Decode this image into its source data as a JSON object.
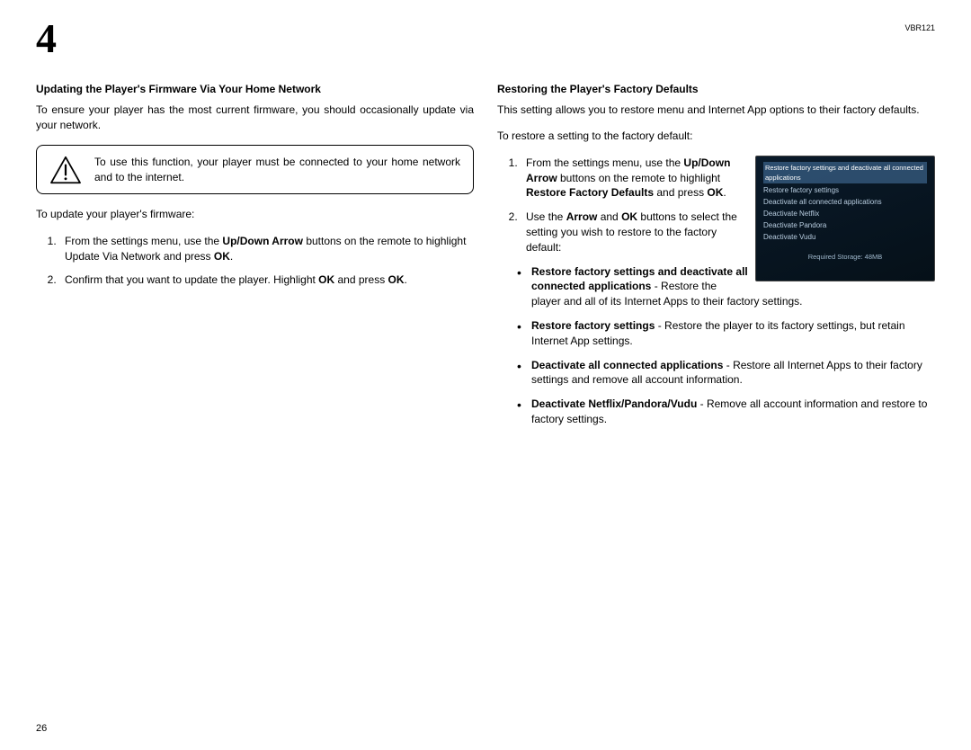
{
  "header": {
    "chapter": "4",
    "model": "VBR121"
  },
  "left": {
    "heading": "Updating the Player's Firmware Via Your Home Network",
    "intro": "To ensure your player has the most current firmware, you should occasionally update via your network.",
    "alert": "To use this function, your player must be connected to your home network and to the internet.",
    "lead": "To update your player's firmware:",
    "steps": {
      "s1_pre": "From the settings menu, use the ",
      "s1_b1": "Up/Down Arrow",
      "s1_mid": " buttons on the remote to highlight Update Via Network and press ",
      "s1_b2": "OK",
      "s1_post": ".",
      "s2_pre": "Confirm that you want to update the player. Highlight ",
      "s2_b1": "OK",
      "s2_mid": " and press ",
      "s2_b2": "OK",
      "s2_post": "."
    }
  },
  "right": {
    "heading": "Restoring the Player's Factory Defaults",
    "intro": "This setting allows you to restore menu and Internet App options to their factory defaults.",
    "lead": "To restore a setting to the factory default:",
    "steps": {
      "s1_pre": "From the settings menu, use the ",
      "s1_b1": "Up/Down Arrow",
      "s1_mid": " buttons on the remote to highlight ",
      "s1_b2": "Restore Factory Defaults",
      "s1_mid2": " and press ",
      "s1_b3": "OK",
      "s1_post": ".",
      "s2_pre": "Use the ",
      "s2_b1": "Arrow",
      "s2_mid": " and ",
      "s2_b2": "OK",
      "s2_post": " buttons to select the setting you wish to restore to the factory default:"
    },
    "bullets": {
      "b1_bold": "Restore factory settings and deactivate all connected applications",
      "b1_rest": " - Restore the player and all of its Internet Apps to their factory settings.",
      "b2_bold": "Restore factory settings",
      "b2_rest": " - Restore the player to its factory settings, but retain Internet App settings.",
      "b3_bold": "Deactivate all connected applications",
      "b3_rest": " - Restore all Internet Apps to their factory settings and remove all account information.",
      "b4_bold": "Deactivate Netflix/Pandora/Vudu",
      "b4_rest": " - Remove all account information and restore to factory settings."
    },
    "screenshot": {
      "line1": "Restore factory settings and deactivate all connected applications",
      "line2": "Restore factory settings",
      "line3": "Deactivate all connected applications",
      "line4": "Deactivate Netflix",
      "line5": "Deactivate Pandora",
      "line6": "Deactivate Vudu",
      "footer": "Required Storage: 48MB"
    }
  },
  "page_number": "26"
}
